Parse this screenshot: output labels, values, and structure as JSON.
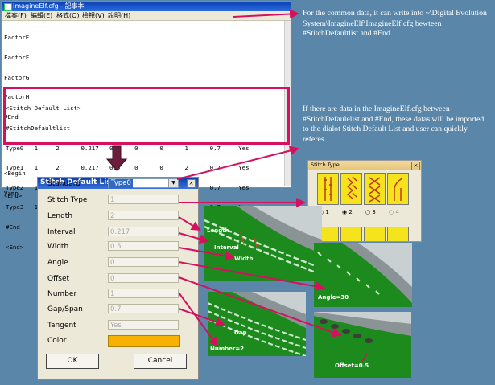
{
  "notepad": {
    "title": "ImagineElf.cfg - 記事本",
    "menu": [
      "檔案(F)",
      "編輯(E)",
      "格式(O)",
      "檢視(V)",
      "說明(H)"
    ],
    "lines_top": [
      "FactorE",
      "FactorF",
      "FactorG",
      "FactorH",
      "#End",
      "",
      "<End>"
    ],
    "list_lines": [
      "<Stitch Default List>",
      "#StitchDefaultlist",
      "Type0   1     2      0.217   0.5    0      0      1      0.7     Yes",
      "Type1   1     2      0.217   0.5    0      0      2      0.7     Yes",
      "Type2   1     3      0.347   0.8    0      0      1      0.7     Yes",
      "Type3   1     4      0.347   0.8    0      0      1      0.7     Yes",
      "#End",
      "<End>"
    ],
    "lines_bottom": [
      "<Begin",
      "Vamp"
    ]
  },
  "annotations": {
    "top": "For the common data, it can write into ~\\Digital Evolution System\\ImagineElf\\ImagineElf.cfg bewteen #StitchDefaultlist and #End.",
    "middle": "If there are data in the ImagineElf.cfg between #StitchDefaulelist and #End, these datas will be imported to the dialot Stitch Default List and user can quickly referes."
  },
  "dialog": {
    "title": "Stitch Default List",
    "close": "×",
    "fields": [
      {
        "label": "Standard",
        "value": "Type0"
      },
      {
        "label": "Stitch Type",
        "value": "1"
      },
      {
        "label": "Length",
        "value": "2"
      },
      {
        "label": "Interval",
        "value": "0.217"
      },
      {
        "label": "Width",
        "value": "0.5"
      },
      {
        "label": "Angle",
        "value": "0"
      },
      {
        "label": "Offset",
        "value": "0"
      },
      {
        "label": "Number",
        "value": "1"
      },
      {
        "label": "Gap/Span",
        "value": "0.7"
      },
      {
        "label": "Tangent",
        "value": "Yes"
      },
      {
        "label": "Color",
        "value": ""
      }
    ],
    "color": "#f9b100",
    "ok": "OK",
    "cancel": "Cancel"
  },
  "stitch_type_window": {
    "title": "Stitch Type",
    "radios": [
      "1",
      "2",
      "3",
      "4"
    ]
  },
  "image_labels": {
    "length": "Length",
    "interval": "Interval",
    "width": "Width",
    "angle": "Angle=30",
    "gap": "Gap",
    "number": "Number=2",
    "offset": "Offset=0.5"
  },
  "colors": {
    "background": "#5a87a9",
    "arrow": "#d6105f",
    "highlight": "#d6105f",
    "fabric": "#1c8a1c"
  }
}
